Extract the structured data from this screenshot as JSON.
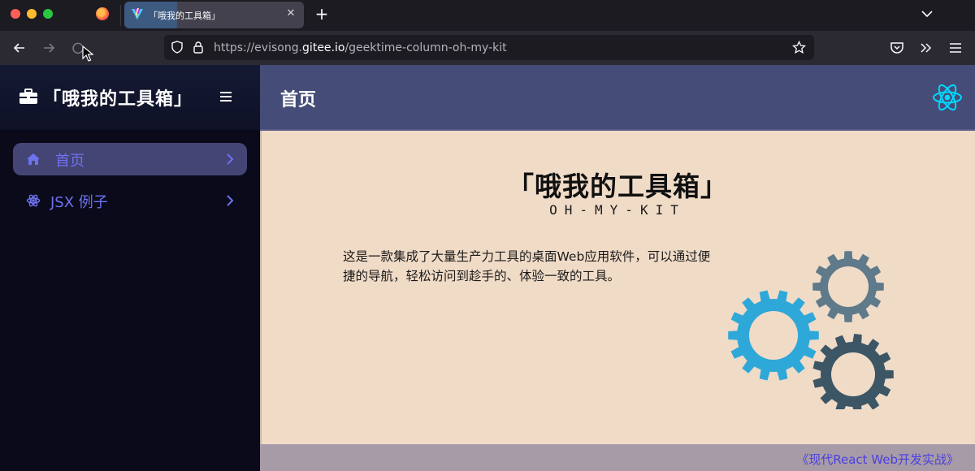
{
  "browser": {
    "tab": {
      "title": "「哦我的工具箱」",
      "active": true
    },
    "url": {
      "prefix": "https://evisong.",
      "domain": "gitee.io",
      "path": "/geektime-column-oh-my-kit"
    }
  },
  "sidebar": {
    "title": "「哦我的工具箱」",
    "items": [
      {
        "label": "首页",
        "icon": "home-icon",
        "active": true
      },
      {
        "label": "JSX 例子",
        "icon": "react-atom-icon",
        "active": false
      }
    ]
  },
  "header": {
    "title": "首页"
  },
  "main": {
    "title": "「哦我的工具箱」",
    "subtitle": "OH-MY-KIT",
    "description": "这是一款集成了大量生产力工具的桌面Web应用软件，可以通过便捷的导航，轻松访问到趁手的、体验一致的工具。"
  },
  "footer": {
    "link": "《现代React Web开发实战》"
  },
  "colors": {
    "accent": "#6e72f0",
    "header_bg": "#444c77",
    "main_bg": "#f0dbc7",
    "sidebar_bg": "#0a0a1a",
    "footer_bg": "#a89ba8",
    "gear_blue": "#2ea8d8",
    "gear_gray": "#5f7a8a",
    "gear_dark": "#3c5666"
  }
}
